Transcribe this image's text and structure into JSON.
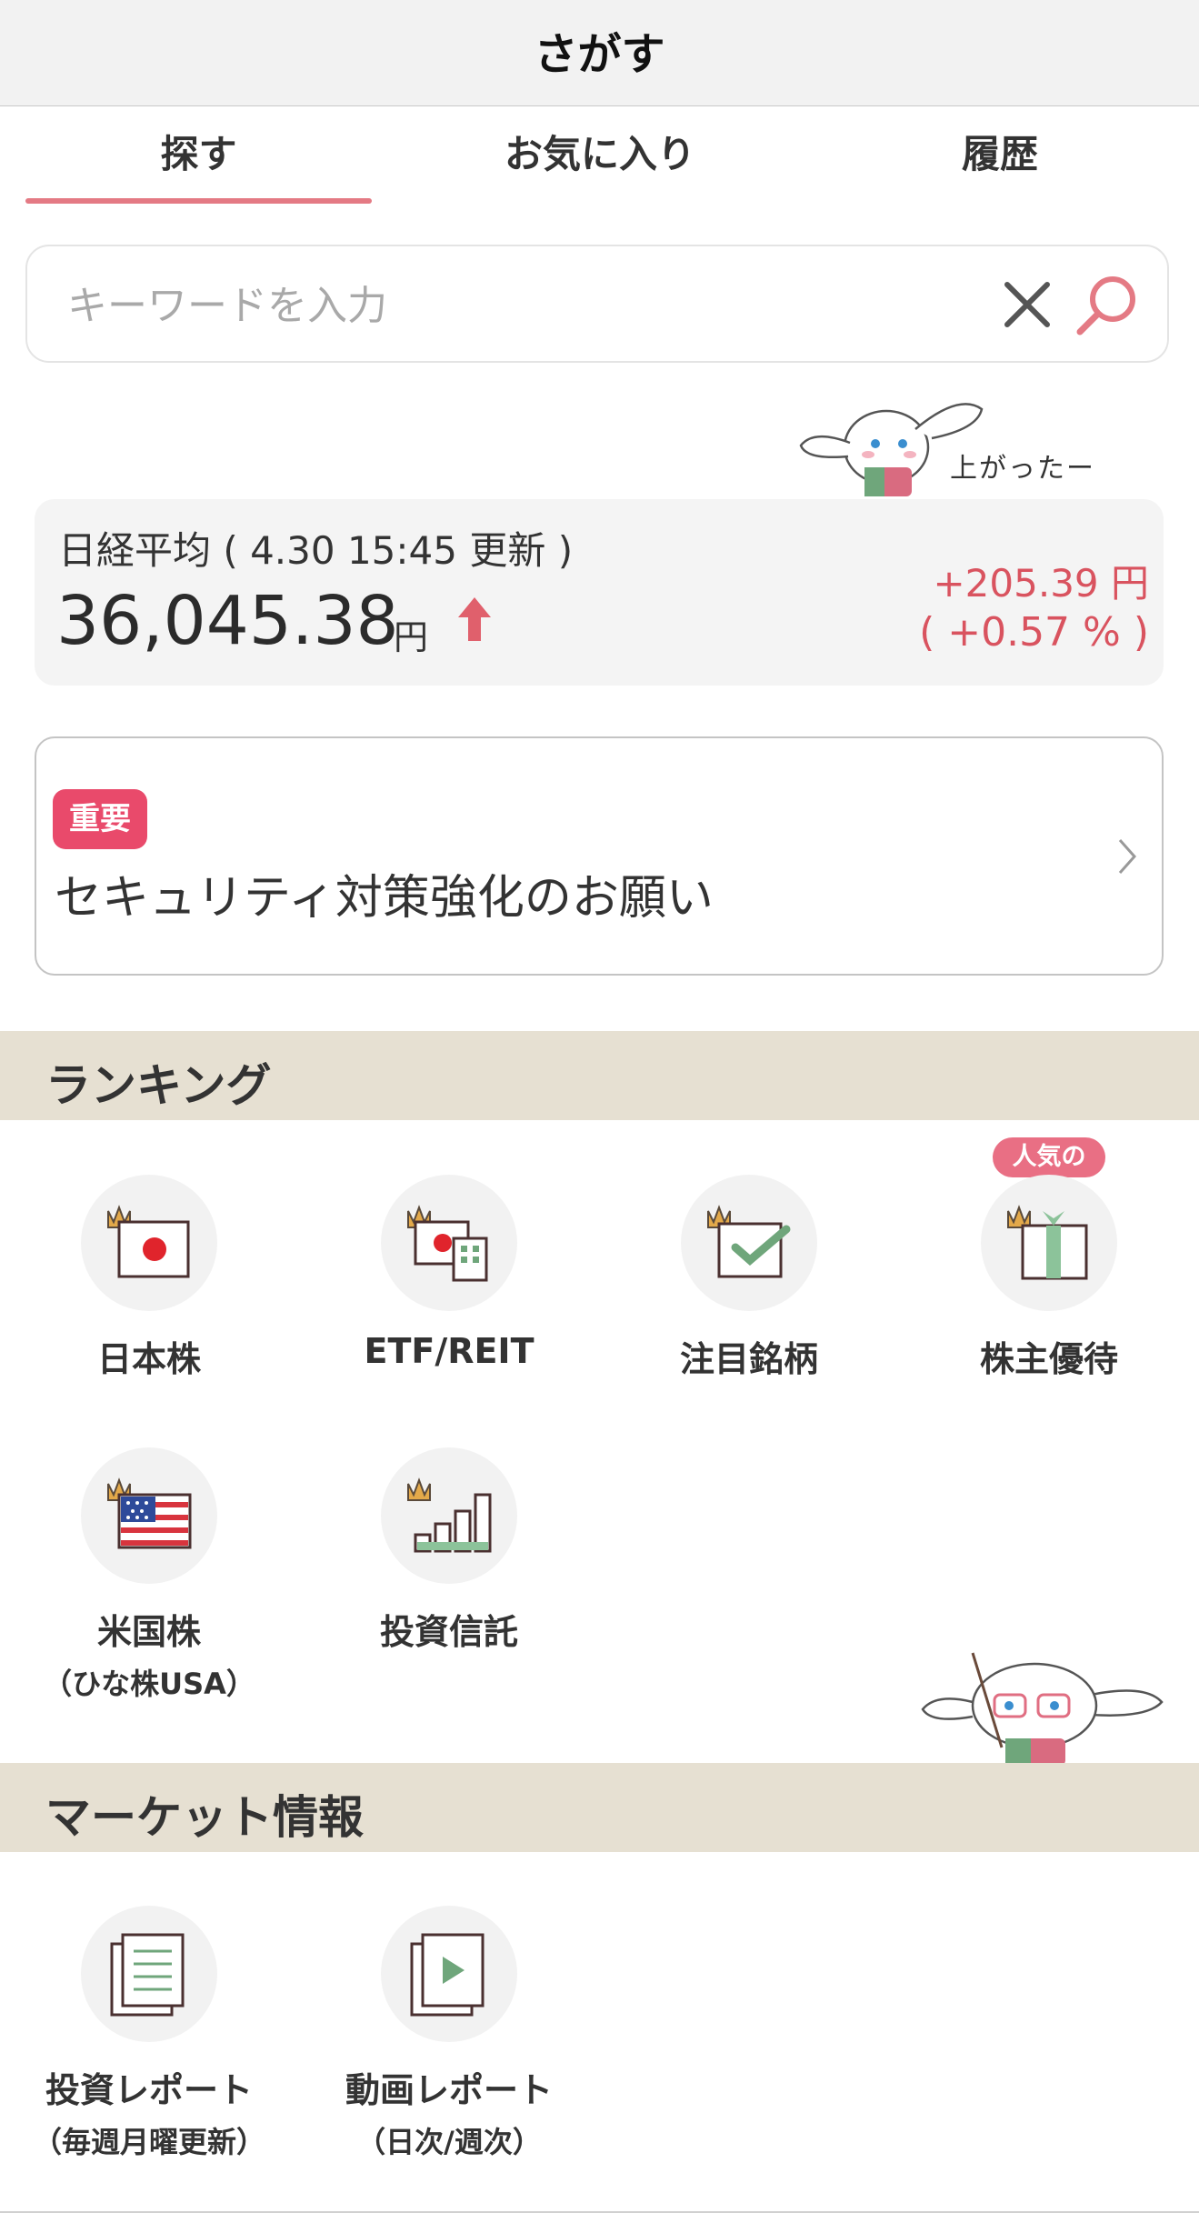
{
  "header": {
    "title": "さがす"
  },
  "tabs": [
    {
      "label": "探す",
      "active": true
    },
    {
      "label": "お気に入り",
      "active": false
    },
    {
      "label": "履歴",
      "active": false
    }
  ],
  "search": {
    "placeholder": "キーワードを入力",
    "value": ""
  },
  "mascot": {
    "bubble_text": "上がったー"
  },
  "index": {
    "name_line": "日経平均 ( 4.30 15:45 更新 )",
    "value": "36,045.38",
    "unit": "円",
    "change": "+205.39 円",
    "change_pct": "( +0.57 % )",
    "direction": "up"
  },
  "notice": {
    "badge": "重要",
    "text": "セキュリティ対策強化のお願い"
  },
  "ranking": {
    "title": "ランキング",
    "popular_badge": "人気の",
    "items": [
      {
        "label": "日本株",
        "sub": "",
        "icon": "japan-flag-icon"
      },
      {
        "label": "ETF/REIT",
        "sub": "",
        "icon": "building-icon"
      },
      {
        "label": "注目銘柄",
        "sub": "",
        "icon": "checkbox-icon"
      },
      {
        "label": "株主優待",
        "sub": "",
        "icon": "gift-icon"
      },
      {
        "label": "米国株",
        "sub": "（ひな株USA）",
        "icon": "us-flag-icon"
      },
      {
        "label": "投資信託",
        "sub": "",
        "icon": "bar-chart-icon"
      }
    ]
  },
  "market": {
    "title": "マーケット情報",
    "items": [
      {
        "label": "投資レポート",
        "sub": "（毎週月曜更新）",
        "icon": "document-icon"
      },
      {
        "label": "動画レポート",
        "sub": "（日次/週次）",
        "icon": "video-icon"
      }
    ]
  },
  "colors": {
    "accent": "#e47a84",
    "up": "#d9535f",
    "section_bg": "#e6e0d2",
    "badge": "#e94a6b"
  }
}
